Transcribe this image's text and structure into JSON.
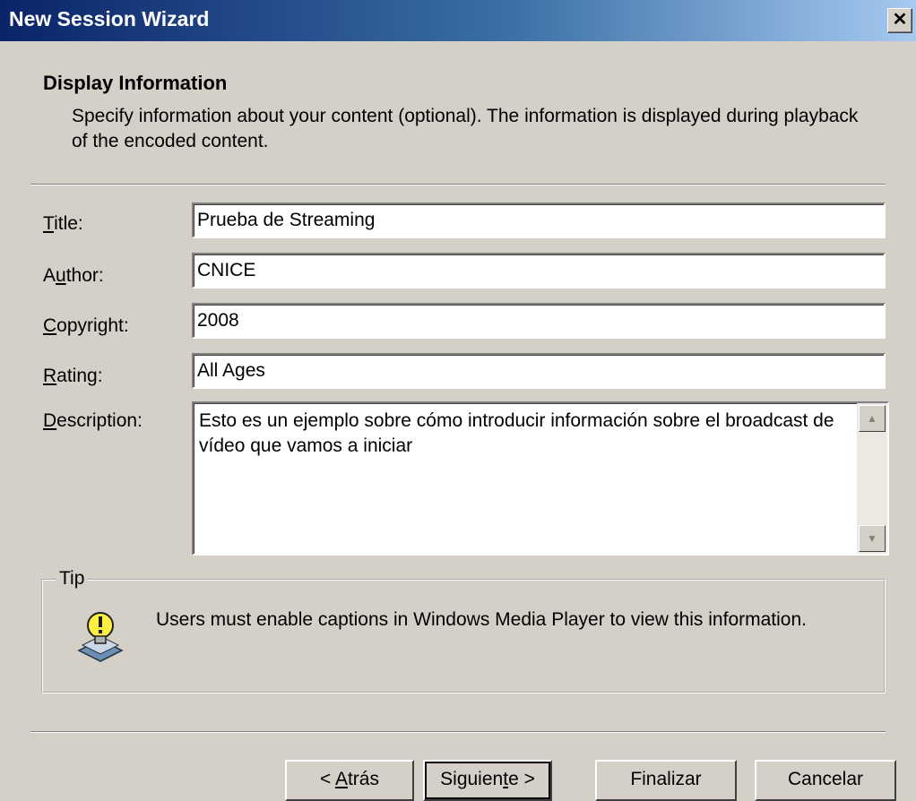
{
  "window": {
    "title": "New Session Wizard",
    "close_glyph": "✕"
  },
  "header": {
    "title": "Display Information",
    "subtitle": "Specify information about your content (optional). The information is displayed during playback of the encoded content."
  },
  "form": {
    "title": {
      "label_pre": "",
      "label_key": "T",
      "label_post": "itle:",
      "value": "Prueba de Streaming"
    },
    "author": {
      "label_pre": "A",
      "label_key": "u",
      "label_post": "thor:",
      "value": "CNICE"
    },
    "copyright": {
      "label_pre": "",
      "label_key": "C",
      "label_post": "opyright:",
      "value": "2008"
    },
    "rating": {
      "label_pre": "",
      "label_key": "R",
      "label_post": "ating:",
      "value": "All Ages"
    },
    "description": {
      "label_pre": "",
      "label_key": "D",
      "label_post": "escription:",
      "value": "Esto es un ejemplo sobre cómo introducir información sobre el broadcast de vídeo que vamos a iniciar"
    }
  },
  "tip": {
    "legend": "Tip",
    "text": "Users must enable captions in Windows Media Player to view this information.",
    "icon": "lightbulb-icon"
  },
  "buttons": {
    "back": {
      "pre": "< ",
      "key": "A",
      "post": "trás"
    },
    "next": {
      "pre": "Siguien",
      "key": "t",
      "post": "e >"
    },
    "finish": "Finalizar",
    "cancel": "Cancelar"
  },
  "colors": {
    "titlebar_start": "#0a246a",
    "titlebar_end": "#a6caf0",
    "dialog_bg": "#d4d0c8"
  }
}
